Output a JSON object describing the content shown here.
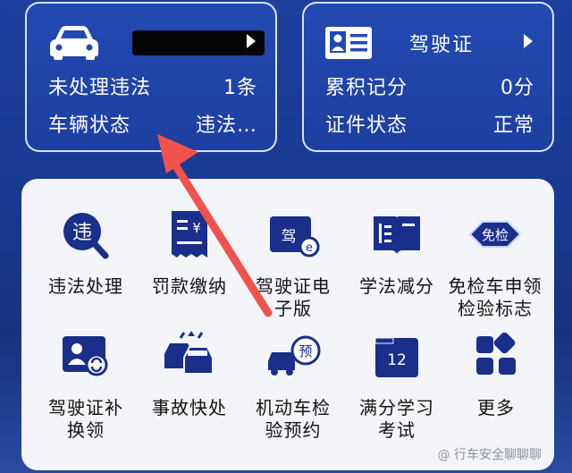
{
  "vehicle_card": {
    "plate_redacted": true,
    "row1_label": "未处理违法",
    "row1_value": "1条",
    "row2_label": "车辆状态",
    "row2_value": "违法…"
  },
  "license_card": {
    "title": "驾驶证",
    "row1_label": "累积记分",
    "row1_value": "0分",
    "row2_label": "证件状态",
    "row2_value": "正常"
  },
  "services": [
    {
      "label": "违法处理",
      "icon": "violation-icon",
      "badge": "违"
    },
    {
      "label": "罚款缴纳",
      "icon": "fine-receipt-icon",
      "badge": "¥"
    },
    {
      "label": "驾驶证电\n子版",
      "icon": "e-license-icon",
      "badge": "驾"
    },
    {
      "label": "学法减分",
      "icon": "study-book-icon"
    },
    {
      "label": "免检车申领\n检验标志",
      "icon": "inspection-exempt-icon",
      "badge": "免检"
    },
    {
      "label": "驾驶证补\n换领",
      "icon": "license-replace-icon"
    },
    {
      "label": "事故快处",
      "icon": "accident-icon"
    },
    {
      "label": "机动车检\n验预约",
      "icon": "inspection-booking-icon",
      "badge": "预"
    },
    {
      "label": "满分学习\n考试",
      "icon": "full-score-exam-icon",
      "badge": "12"
    },
    {
      "label": "更多",
      "icon": "more-icon"
    }
  ],
  "watermark": "@ 行车安全聊聊聊",
  "colors": {
    "background": "#1d3f9e",
    "icon_navy": "#1a2f8a",
    "panel": "#f4f5f9",
    "annotation_arrow": "#f0524d"
  }
}
